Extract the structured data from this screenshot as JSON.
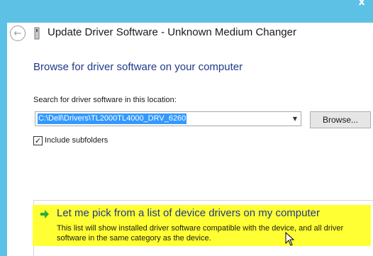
{
  "window": {
    "title": "Update Driver Software - Unknown Medium Changer",
    "close_glyph": "x"
  },
  "page": {
    "heading": "Browse for driver software on your computer",
    "search_label": "Search for driver software in this location:",
    "path_value": "C:\\Dell\\Drivers\\TL2000TL4000_DRV_6260",
    "browse_label": "Browse...",
    "include_subfolders_label": "Include subfolders",
    "include_subfolders_checked": true
  },
  "pick_option": {
    "title": "Let me pick from a list of device drivers on my computer",
    "description": "This list will show installed driver software compatible with the device, and all driver software in the same category as the device.",
    "icon": "green-arrow-icon",
    "highlight_color": "#ffff33"
  },
  "colors": {
    "accent_blue": "#1e3a8a",
    "chrome": "#5cc1e4",
    "selection": "#3399ff"
  }
}
